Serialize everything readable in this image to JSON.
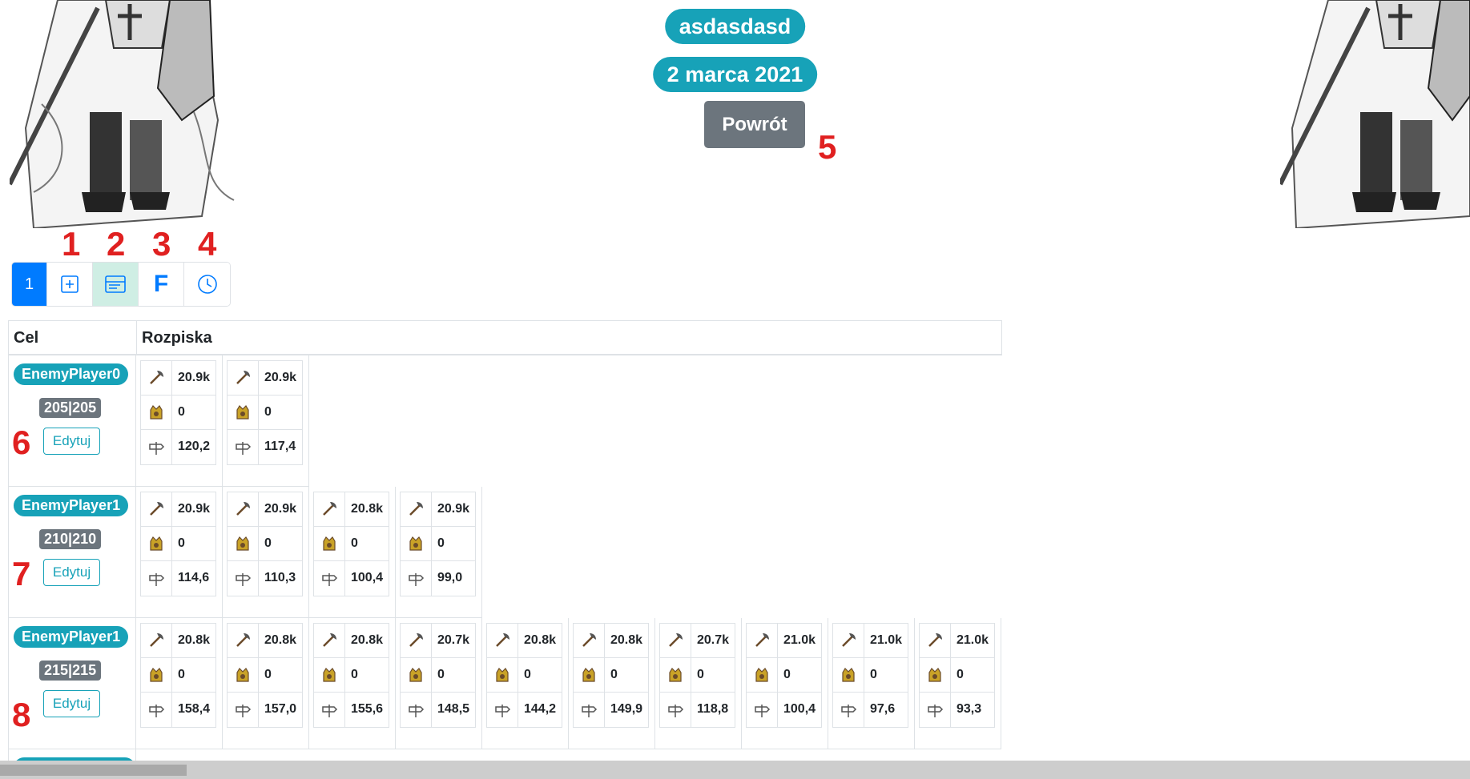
{
  "header": {
    "title": "asdasdasd",
    "date": "2 marca 2021",
    "back_label": "Powrót"
  },
  "annotations": [
    "1",
    "2",
    "3",
    "4",
    "5",
    "6",
    "7",
    "8"
  ],
  "tabs": [
    {
      "label": "1",
      "icon": "page-number"
    },
    {
      "icon": "plus-square-icon"
    },
    {
      "icon": "list-card-icon"
    },
    {
      "icon": "letter-f-icon",
      "label": "F"
    },
    {
      "icon": "clock-icon"
    }
  ],
  "table": {
    "col_target": "Cel",
    "col_plan": "Rozpiska",
    "edit_label": "Edytuj",
    "rows": [
      {
        "name": "EnemyPlayer0",
        "coord": "205|205",
        "groups": [
          {
            "axe": "20.9k",
            "noble": "0",
            "dist": "120,2"
          },
          {
            "axe": "20.9k",
            "noble": "0",
            "dist": "117,4"
          }
        ]
      },
      {
        "name": "EnemyPlayer1",
        "coord": "210|210",
        "groups": [
          {
            "axe": "20.9k",
            "noble": "0",
            "dist": "114,6"
          },
          {
            "axe": "20.9k",
            "noble": "0",
            "dist": "110,3"
          },
          {
            "axe": "20.8k",
            "noble": "0",
            "dist": "100,4"
          },
          {
            "axe": "20.9k",
            "noble": "0",
            "dist": "99,0"
          }
        ]
      },
      {
        "name": "EnemyPlayer1",
        "coord": "215|215",
        "groups": [
          {
            "axe": "20.8k",
            "noble": "0",
            "dist": "158,4"
          },
          {
            "axe": "20.8k",
            "noble": "0",
            "dist": "157,0"
          },
          {
            "axe": "20.8k",
            "noble": "0",
            "dist": "155,6"
          },
          {
            "axe": "20.7k",
            "noble": "0",
            "dist": "148,5"
          },
          {
            "axe": "20.8k",
            "noble": "0",
            "dist": "144,2"
          },
          {
            "axe": "20.8k",
            "noble": "0",
            "dist": "149,9"
          },
          {
            "axe": "20.7k",
            "noble": "0",
            "dist": "118,8"
          },
          {
            "axe": "21.0k",
            "noble": "0",
            "dist": "100,4"
          },
          {
            "axe": "21.0k",
            "noble": "0",
            "dist": "97,6"
          },
          {
            "axe": "21.0k",
            "noble": "0",
            "dist": "93,3"
          }
        ]
      }
    ]
  },
  "colors": {
    "teal": "#17a2b8",
    "gray": "#6c757d",
    "blue": "#007bff",
    "annotation": "#e02020"
  }
}
